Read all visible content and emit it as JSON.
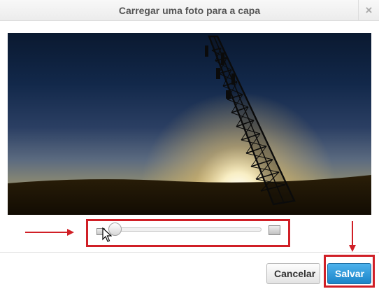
{
  "dialog": {
    "title": "Carregar uma foto para a capa",
    "close_glyph": "×"
  },
  "photo": {
    "subject": "photo-preview-image"
  },
  "zoom": {
    "level": 0.05,
    "small_icon": "zoom-out-image-icon",
    "large_icon": "zoom-in-image-icon"
  },
  "buttons": {
    "cancel_label": "Cancelar",
    "save_label": "Salvar"
  },
  "colors": {
    "annotation": "#d01f26",
    "primary": "#1b84c8"
  }
}
